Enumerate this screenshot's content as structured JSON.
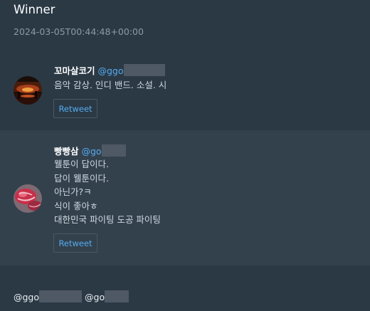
{
  "header": {
    "title": "Winner",
    "timestamp": "2024-03-05T00:44:48+00:00"
  },
  "candidates": [
    {
      "display_name": "꼬마살코기",
      "handle_prefix": "@ggo",
      "avatar": "sunset-photo",
      "bio_lines": [
        "음악 감상. 인디 밴드. 소설. 시"
      ],
      "retweet_label": "Retweet"
    },
    {
      "display_name": "빵빵삼",
      "handle_prefix": "@go",
      "avatar": "meat-photo",
      "bio_lines": [
        "웰툰이 답이다.",
        "답이 웰툰이다.",
        "아닌가?ㅋ",
        "식이 좋아ㅎ",
        "대한민국 파이팅 도공 파이팅"
      ],
      "retweet_label": "Retweet"
    }
  ],
  "footer": {
    "mention_1": "@ggo",
    "mention_2": "@go"
  },
  "colors": {
    "background": "#2b3945",
    "highlight_row": "#33414d",
    "accent": "#55acee",
    "redaction": "#4f5965"
  }
}
